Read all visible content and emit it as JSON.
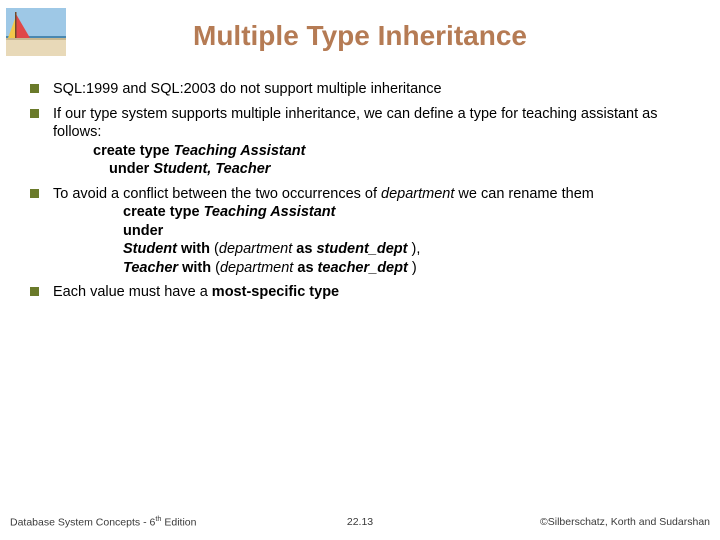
{
  "title": "Multiple Type Inheritance",
  "bullets": {
    "b1": "SQL:1999 and SQL:2003 do not support multiple inheritance",
    "b2": "If our type system supports multiple inheritance, we can define a type for teaching assistant as follows:",
    "b2_code1_a": "create type",
    "b2_code1_b": "Teaching Assistant",
    "b2_code2_a": "under",
    "b2_code2_b": "Student, Teacher",
    "b3_a": "To avoid a conflict between the two occurrences of ",
    "b3_dept": "department",
    "b3_b": " we can rename them",
    "b3_code1_a": "create type",
    "b3_code1_b": "Teaching Assistant",
    "b3_code2": "under",
    "b3_code3_a": "Student",
    "b3_code3_b": "with",
    "b3_code3_c": "department",
    "b3_code3_d": "as",
    "b3_code3_e": "student_dept",
    "b3_code4_a": "Teacher",
    "b3_code4_b": "with",
    "b3_code4_c": "department",
    "b3_code4_d": "as",
    "b3_code4_e": "teacher_dept",
    "b4_a": "Each value must have a ",
    "b4_b": "most-specific type"
  },
  "footer": {
    "left_a": "Database System Concepts - 6",
    "left_b": " Edition",
    "left_sup": "th",
    "center": "22.13",
    "right": "©Silberschatz, Korth and Sudarshan"
  }
}
